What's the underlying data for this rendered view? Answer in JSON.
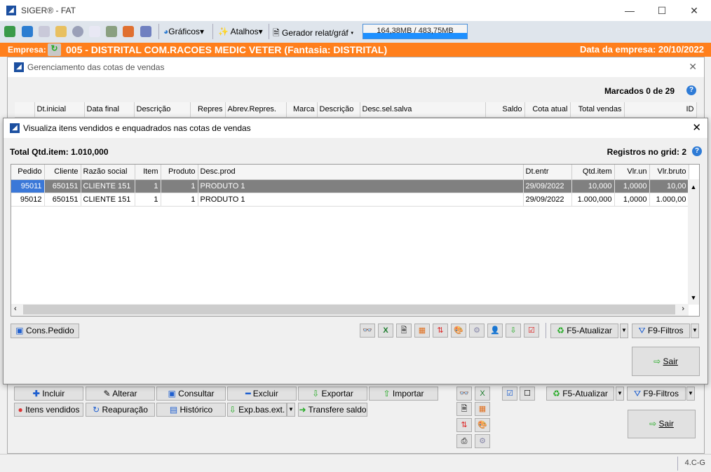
{
  "app": {
    "title": "SIGER® - FAT",
    "version": "4.C-G"
  },
  "toolbar": {
    "graficos": "Gráficos",
    "atalhos": "Atalhos",
    "gerador": "Gerador relat/gráf",
    "memory": "164,38MB / 483,75MB"
  },
  "empresa": {
    "label": "Empresa:",
    "value": "005 - DISTRITAL COM.RACOES MEDIC VETER (Fantasia: DISTRITAL)",
    "date_label": "Data da empresa: 20/10/2022"
  },
  "cotas": {
    "title": "Gerenciamento das cotas de vendas",
    "marcados": "Marcados 0 de 29",
    "columns": [
      "Dt.inicial",
      "Data final",
      "Descrição",
      "Repres",
      "Abrev.Repres.",
      "Marca",
      "Descrição",
      "Desc.sel.salva",
      "Saldo",
      "Cota atual",
      "Total vendas",
      "ID"
    ],
    "buttons": {
      "incluir": "Incluir",
      "alterar": "Alterar",
      "consultar": "Consultar",
      "excluir": "Excluir",
      "exportar": "Exportar",
      "importar": "Importar",
      "itens": "Itens vendidos",
      "reapuracao": "Reapuração",
      "historico": "Histórico",
      "expbas": "Exp.bas.ext.",
      "transfere": "Transfere saldo",
      "atualizar": "F5-Atualizar",
      "filtros": "F9-Filtros",
      "sair": "Sair"
    }
  },
  "dialog": {
    "title": "Visualiza itens vendidos e enquadrados nas cotas de vendas",
    "total": "Total Qtd.item: 1.010,000",
    "registros": "Registros no grid: 2",
    "columns": [
      "Pedido",
      "Cliente",
      "Razão social",
      "Item",
      "Produto",
      "Desc.prod",
      "Dt.entr",
      "Qtd.item",
      "Vlr.un",
      "Vlr.bruto"
    ],
    "rows": [
      [
        "95011",
        "650151",
        "CLIENTE 151",
        "1",
        "1",
        "PRODUTO 1",
        "29/09/2022",
        "10,000",
        "1,0000",
        "10,00"
      ],
      [
        "95012",
        "650151",
        "CLIENTE 151",
        "1",
        "1",
        "PRODUTO 1",
        "29/09/2022",
        "1.000,000",
        "1,0000",
        "1.000,00"
      ]
    ],
    "cons_pedido": "Cons.Pedido",
    "atualizar": "F5-Atualizar",
    "filtros": "F9-Filtros",
    "sair": "Sair"
  }
}
